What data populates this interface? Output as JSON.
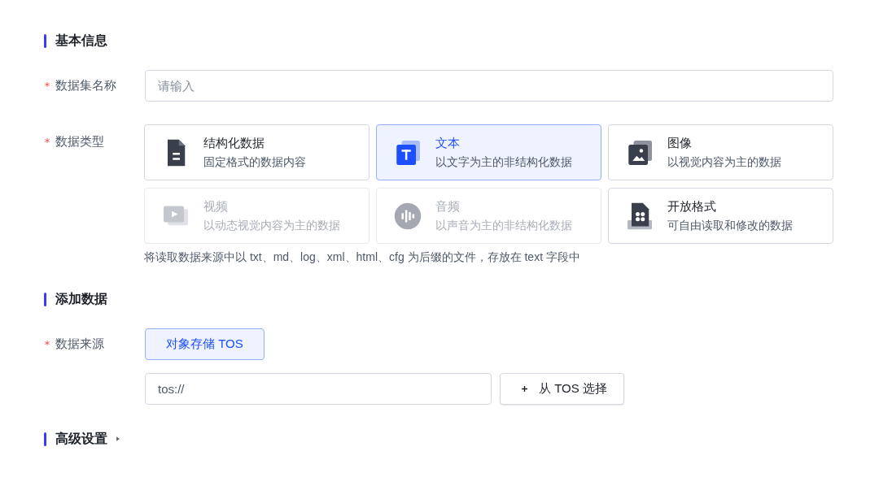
{
  "sections": [
    {
      "title": "基本信息",
      "expanded": true,
      "fields": [
        {
          "kind": "input",
          "label": "数据集名称",
          "required": true,
          "placeholder": "请输入"
        },
        {
          "kind": "cards",
          "label": "数据类型",
          "required": true,
          "hint": "将读取数据来源中以 txt、md、log、xml、html、cfg 为后缀的文件，存放在 text 字段中",
          "options": [
            {
              "kind": "table",
              "title": "结构化数据",
              "desc": "固定格式的数据内容",
              "selected": false,
              "disabled": false
            },
            {
              "kind": "text",
              "title": "文本",
              "desc": "以文字为主的非结构化数据",
              "selected": true,
              "disabled": false
            },
            {
              "kind": "image",
              "title": "图像",
              "desc": "以视觉内容为主的数据",
              "selected": false,
              "disabled": false
            },
            {
              "kind": "video",
              "title": "视频",
              "desc": "以动态视觉内容为主的数据",
              "selected": false,
              "disabled": true
            },
            {
              "kind": "audio",
              "title": "音频",
              "desc": "以声音为主的非结构化数据",
              "selected": false,
              "disabled": true
            },
            {
              "kind": "open",
              "title": "开放格式",
              "desc": "可自由读取和修改的数据",
              "selected": false,
              "disabled": false
            }
          ]
        }
      ]
    },
    {
      "title": "添加数据",
      "expanded": true,
      "fields": [
        {
          "kind": "source",
          "label": "数据来源",
          "required": true,
          "options": [
            {
              "label": "对象存储 TOS",
              "selected": true
            }
          ],
          "value": "tos://",
          "button": "从 TOS 选择"
        }
      ]
    },
    {
      "title": "高级设置",
      "expanded": false
    }
  ]
}
